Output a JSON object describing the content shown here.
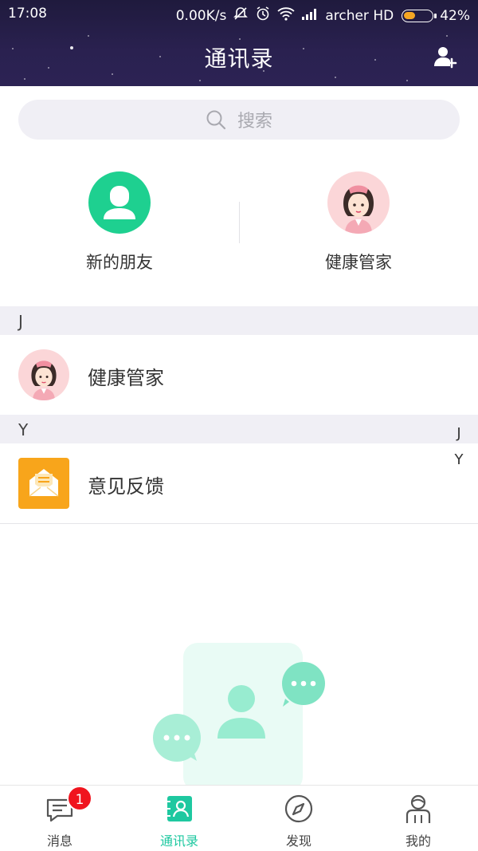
{
  "status_bar": {
    "time": "17:08",
    "net_speed": "0.00K/s",
    "carrier": "archer HD",
    "battery": "42%",
    "battery_level": 0.42
  },
  "header": {
    "title": "通讯录"
  },
  "search": {
    "placeholder": "搜索"
  },
  "quick_entries": [
    {
      "label": "新的朋友",
      "icon": "person-silhouette-icon",
      "color": "#1ed090"
    },
    {
      "label": "健康管家",
      "icon": "nurse-avatar"
    }
  ],
  "sections": [
    {
      "letter": "J",
      "contacts": [
        {
          "name": "健康管家",
          "avatar": "nurse-avatar"
        }
      ]
    },
    {
      "letter": "Y",
      "contacts": [
        {
          "name": "意见反馈",
          "avatar": "envelope-icon",
          "color": "#f8a51b"
        }
      ]
    }
  ],
  "alphabet_index": [
    "J",
    "Y"
  ],
  "bottom_nav": [
    {
      "label": "消息",
      "icon": "message-icon",
      "badge": "1"
    },
    {
      "label": "通讯录",
      "icon": "contacts-book-icon",
      "active": true
    },
    {
      "label": "发现",
      "icon": "compass-icon"
    },
    {
      "label": "我的",
      "icon": "profile-icon"
    }
  ],
  "colors": {
    "accent": "#1ec8a0",
    "header_bg": "#2a2150",
    "badge": "#f0141e",
    "section_bg": "#f0eff5"
  }
}
